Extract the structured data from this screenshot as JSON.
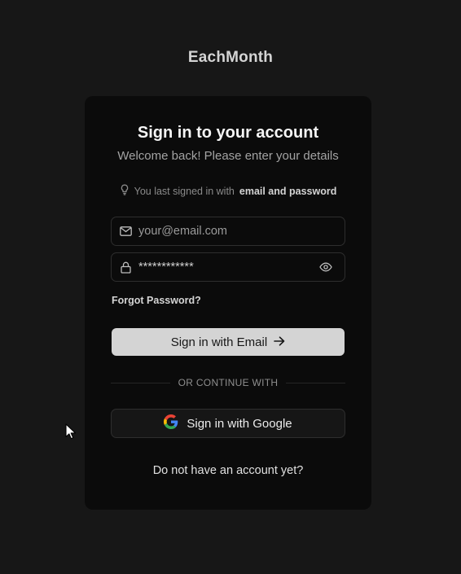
{
  "brand": {
    "name": "EachMonth"
  },
  "card": {
    "title": "Sign in to your account",
    "subtitle": "Welcome back! Please enter your details",
    "last_signed": {
      "prefix": "You last signed in with",
      "method": "email and password"
    },
    "email_field": {
      "placeholder": "your@email.com",
      "value": ""
    },
    "password_field": {
      "value": "************"
    },
    "forgot_password": "Forgot Password?",
    "email_button": "Sign in with Email",
    "divider_text": "OR CONTINUE WITH",
    "google_button": "Sign in with Google",
    "signup_link": "Do not have an account yet?"
  },
  "icons": {
    "mail": "mail-icon",
    "lock": "lock-icon",
    "eye": "eye-icon",
    "arrow": "arrow-right-icon",
    "google": "google-icon",
    "lightbulb": "lightbulb-icon"
  },
  "colors": {
    "page_bg": "#171717",
    "card_bg": "#0b0b0b",
    "primary_button_bg": "#d4d4d4",
    "border": "#2e2e2e"
  }
}
